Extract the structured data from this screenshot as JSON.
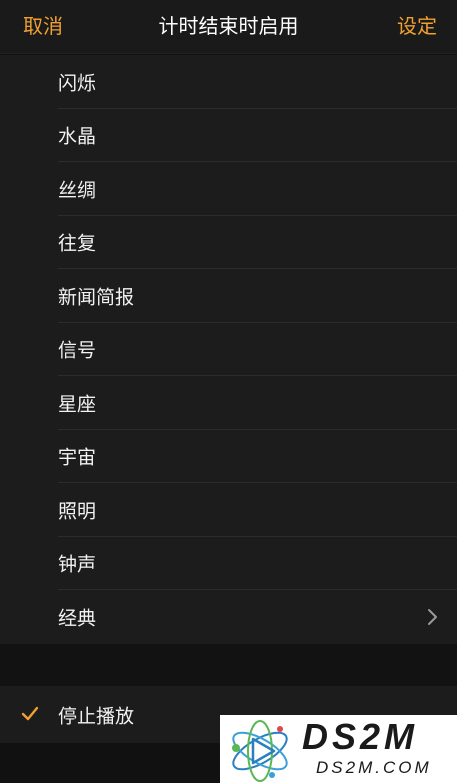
{
  "colors": {
    "accent": "#f0a030",
    "background": "#111111",
    "row_background": "#1c1c1c",
    "text": "#f2f2f2"
  },
  "nav": {
    "cancel_label": "取消",
    "title": "计时结束时启用",
    "set_label": "设定"
  },
  "list": {
    "items": [
      {
        "label": "闪烁"
      },
      {
        "label": "水晶"
      },
      {
        "label": "丝绸"
      },
      {
        "label": "往复"
      },
      {
        "label": "新闻简报"
      },
      {
        "label": "信号"
      },
      {
        "label": "星座"
      },
      {
        "label": "宇宙"
      },
      {
        "label": "照明"
      },
      {
        "label": "钟声"
      },
      {
        "label": "经典",
        "icon": "chevron-right-icon"
      }
    ]
  },
  "stop_playback": {
    "label": "停止播放",
    "selected": true,
    "icon": "checkmark-icon"
  },
  "watermark": {
    "brand": "DS2M",
    "domain": "DS2M.COM"
  }
}
